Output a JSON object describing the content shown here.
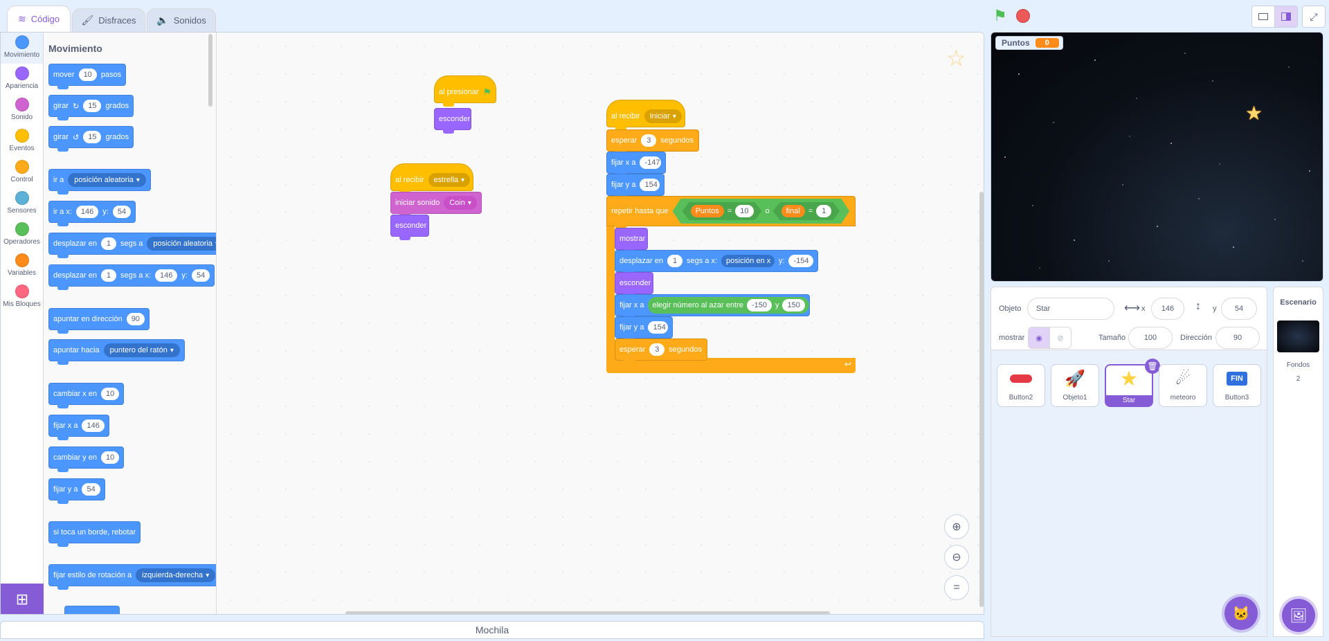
{
  "tabs": {
    "code": "Código",
    "costumes": "Disfraces",
    "sounds": "Sonidos"
  },
  "categories": [
    {
      "label": "Movimiento",
      "color": "#4c97ff"
    },
    {
      "label": "Apariencia",
      "color": "#9966ff"
    },
    {
      "label": "Sonido",
      "color": "#cf63cf"
    },
    {
      "label": "Eventos",
      "color": "#ffbf00"
    },
    {
      "label": "Control",
      "color": "#ffab19"
    },
    {
      "label": "Sensores",
      "color": "#5cb1d6"
    },
    {
      "label": "Operadores",
      "color": "#59c059"
    },
    {
      "label": "Variables",
      "color": "#ff8c1a"
    },
    {
      "label": "Mis Bloques",
      "color": "#ff6680"
    }
  ],
  "palette": {
    "title": "Movimiento",
    "move": {
      "a": "mover",
      "v": "10",
      "b": "pasos"
    },
    "turn_right": {
      "a": "girar",
      "v": "15",
      "b": "grados"
    },
    "turn_left": {
      "a": "girar",
      "v": "15",
      "b": "grados"
    },
    "goto": {
      "a": "ir a",
      "d": "posición aleatoria"
    },
    "goto_xy": {
      "a": "ir a x:",
      "x": "146",
      "b": "y:",
      "y": "54"
    },
    "glide_to": {
      "a": "desplazar en",
      "v": "1",
      "b": "segs a",
      "d": "posición aleatoria"
    },
    "glide_xy": {
      "a": "desplazar en",
      "v": "1",
      "b": "segs a x:",
      "x": "146",
      "c": "y:",
      "y": "54"
    },
    "point_dir": {
      "a": "apuntar en dirección",
      "v": "90"
    },
    "point_towards": {
      "a": "apuntar hacia",
      "d": "puntero del ratón"
    },
    "change_x": {
      "a": "cambiar x en",
      "v": "10"
    },
    "set_x": {
      "a": "fijar x a",
      "v": "146"
    },
    "change_y": {
      "a": "cambiar y en",
      "v": "10"
    },
    "set_y": {
      "a": "fijar y a",
      "v": "54"
    },
    "bounce": "si toca un borde, rebotar",
    "rotation": {
      "a": "fijar estilo de rotación a",
      "d": "izquierda-derecha"
    }
  },
  "script1": {
    "hat": "al presionar",
    "hide": "esconder"
  },
  "script2": {
    "hat": "al recibir",
    "msg": "estrella",
    "sound_a": "iniciar sonido",
    "sound": "Coin",
    "hide": "esconder"
  },
  "script3": {
    "hat": "al recibir",
    "msg": "Iniciar",
    "wait1": {
      "a": "esperar",
      "v": "3",
      "b": "segundos"
    },
    "setx": {
      "a": "fijar x a",
      "v": "-147"
    },
    "sety": {
      "a": "fijar y a",
      "v": "154"
    },
    "repeat": {
      "a": "repetir hasta que",
      "var1": "Puntos",
      "eq": "=",
      "v1": "10",
      "or": "o",
      "var2": "final",
      "eq2": "=",
      "v2": "1"
    },
    "show": "mostrar",
    "glide": {
      "a": "desplazar en",
      "v": "1",
      "b": "segs a x:",
      "d": "posición en x",
      "c": "y:",
      "y": "-154"
    },
    "hide": "esconder",
    "setx2": {
      "a": "fijar x a",
      "r": "elegir número al azar entre",
      "v1": "-150",
      "y": "y",
      "v2": "150"
    },
    "sety2": {
      "a": "fijar y a",
      "v": "154"
    },
    "wait2": {
      "a": "esperar",
      "v": "3",
      "b": "segundos"
    }
  },
  "backpack": "Mochila",
  "monitor": {
    "label": "Puntos",
    "value": "0"
  },
  "sprite_info": {
    "obj_label": "Objeto",
    "obj": "Star",
    "x_label": "x",
    "x": "146",
    "y_label": "y",
    "y": "54",
    "show_label": "mostrar",
    "size_label": "Tamaño",
    "size": "100",
    "dir_label": "Dirección",
    "dir": "90"
  },
  "sprites": [
    {
      "name": "Button2",
      "icon": "red-pill-icon"
    },
    {
      "name": "Objeto1",
      "icon": "rocket-icon"
    },
    {
      "name": "Star",
      "icon": "star-icon",
      "selected": true
    },
    {
      "name": "meteoro",
      "icon": "meteor-icon"
    },
    {
      "name": "Button3",
      "icon": "fin-icon",
      "text": "FIN"
    }
  ],
  "stage_pane": {
    "title": "Escenario",
    "backdrops_label": "Fondos",
    "backdrops": "2"
  }
}
